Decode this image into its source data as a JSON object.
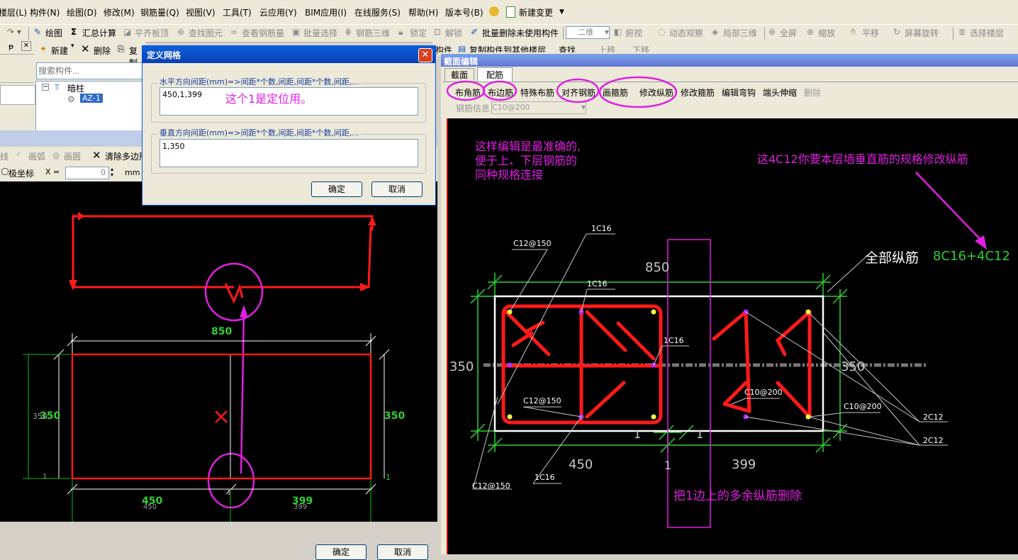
{
  "menu": [
    "楼层(L)",
    "构件(N)",
    "绘图(D)",
    "修改(M)",
    "钢筋量(Q)",
    "视图(V)",
    "工具(T)",
    "云应用(Y)",
    "BIM应用(I)",
    "在线服务(S)",
    "帮助(H)",
    "版本号(B)",
    "新建变更"
  ],
  "toolbar": [
    "绘图",
    "汇总计算",
    "平齐板顶",
    "查找图元",
    "查看钢筋量",
    "批量选择",
    "钢筋三维",
    "锁定",
    "解锁",
    "批量删除未使用构件",
    "二维",
    "俯视",
    "动态观察",
    "局部三维",
    "全屏",
    "缩放",
    "平移",
    "屏幕旋转",
    "选择楼层"
  ],
  "left_panel": {
    "new_label": "新建",
    "delete_label": "删除",
    "copy_label": "复制",
    "search_placeholder": "搜索构件...",
    "tree_root": "暗柱",
    "tree_item": "AZ-1",
    "draw_tools": [
      "线",
      "画弧",
      "画圆",
      "清除多边形"
    ],
    "polar_label": "极坐标",
    "x_label": "X =",
    "x_value": "0",
    "unit": "mm"
  },
  "dialog": {
    "title": "定义网格",
    "h_label": "水平方向间距(mm)=>间距*个数,间距,间距*个数,间距,...",
    "h_value": "450,1,399",
    "h_note": "这个1是定位用。",
    "v_label": "垂直方向间距(mm)=>间距*个数,间距,间距*个数,间距,...",
    "v_value": "1,350",
    "ok": "确定",
    "cancel": "取消"
  },
  "left_drawing": {
    "top_dim": "850",
    "left_dim": "350",
    "left_dim_small": "350",
    "right_dim": "350",
    "bottom_left": "450",
    "bottom_left_small": "450",
    "bottom_right": "399",
    "bottom_right_small": "399",
    "small_one_a": "1",
    "small_one_b": "1",
    "small_one_c": "1",
    "ok": "确定",
    "cancel": "取消"
  },
  "right_panel": {
    "title": "截面编辑",
    "tab_section": "截面",
    "tab_rebar": "配筋",
    "buttons": [
      "布角筋",
      "布边筋",
      "特殊布筋",
      "对齐钢筋",
      "画箍筋",
      "修改纵筋",
      "修改箍筋",
      "编辑弯钩",
      "端头伸缩",
      "删除"
    ],
    "rebar_info_label": "钢筋信息",
    "rebar_info_value": "C10@200",
    "behind_text_a": "构件",
    "behind_text_b": "复制构件到其他楼层",
    "behind_text_c": "查找",
    "behind_text_d": "上移",
    "behind_text_e": "下移"
  },
  "section_drawing": {
    "note1_line1": "这样编辑是最准确的,",
    "note1_line2": "便于上、下层钢筋的",
    "note1_line3": "同种规格连接",
    "note2": "这4C12你要本层墙垂直筋的规格修改纵筋",
    "full_label": "全部纵筋",
    "full_value": "8C16+4C12",
    "dim_top": "850",
    "dim_left": "350",
    "dim_right": "350",
    "dim_bottom_left": "450",
    "dim_bottom_right": "399",
    "dim_one_left": "1",
    "dim_one_right": "1",
    "dim_one_bottom": "1",
    "labels": {
      "c12_150_top": "C12@150",
      "c16_a": "1C16",
      "c16_b": "1C16",
      "c16_c": "1C16",
      "c12_150_mid": "C12@150",
      "c10_200_a": "C10@200",
      "c10_200_b": "C10@200",
      "c12_a": "2C12",
      "c12_b": "2C12",
      "c16_bottom": "1C16",
      "c12_150_bottom": "C12@150"
    },
    "delete_note": "把1边上的多余纵筋删除"
  }
}
